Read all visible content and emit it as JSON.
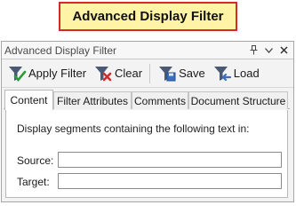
{
  "callout": {
    "text": "Advanced Display Filter"
  },
  "panel": {
    "title": "Advanced Display Filter",
    "controls": {
      "pin_icon": "pin-icon",
      "dropdown_icon": "chevron-down-icon",
      "close_icon": "close-icon"
    }
  },
  "toolbar": {
    "apply_label": "Apply Filter",
    "clear_label": "Clear",
    "save_label": "Save",
    "load_label": "Load"
  },
  "tabs": [
    {
      "label": "Content",
      "active": true
    },
    {
      "label": "Filter Attributes",
      "active": false
    },
    {
      "label": "Comments",
      "active": false
    },
    {
      "label": "Document Structure",
      "active": false
    }
  ],
  "content": {
    "description": "Display segments containing the following text in:",
    "source_label": "Source:",
    "source_value": "",
    "target_label": "Target:",
    "target_value": ""
  },
  "colors": {
    "callout_background": "#fff3a6",
    "callout_border": "#d8272f",
    "funnel": "#4a5a74",
    "check_green": "#2e9b3a",
    "clear_red": "#d42a2a",
    "save_blue": "#3a6fbf"
  }
}
